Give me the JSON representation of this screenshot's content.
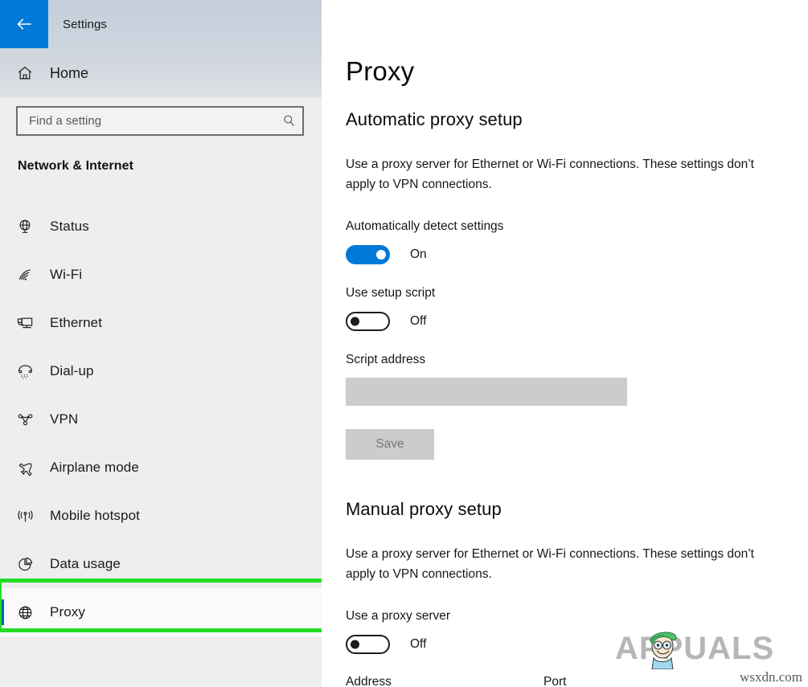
{
  "window": {
    "title": "Settings",
    "back_icon": "back-arrow-icon"
  },
  "sidebar": {
    "home": {
      "label": "Home",
      "icon": "home-icon"
    },
    "search": {
      "value": "",
      "placeholder": "Find a setting",
      "icon": "search-icon"
    },
    "category": "Network & Internet",
    "items": [
      {
        "label": "Status",
        "icon": "globe-icon",
        "selected": false
      },
      {
        "label": "Wi-Fi",
        "icon": "wifi-icon",
        "selected": false
      },
      {
        "label": "Ethernet",
        "icon": "ethernet-icon",
        "selected": false
      },
      {
        "label": "Dial-up",
        "icon": "dialup-phone-icon",
        "selected": false
      },
      {
        "label": "VPN",
        "icon": "vpn-icon",
        "selected": false
      },
      {
        "label": "Airplane mode",
        "icon": "airplane-icon",
        "selected": false
      },
      {
        "label": "Mobile hotspot",
        "icon": "hotspot-icon",
        "selected": false
      },
      {
        "label": "Data usage",
        "icon": "pie-chart-icon",
        "selected": false
      },
      {
        "label": "Proxy",
        "icon": "globe-grid-icon",
        "selected": true
      }
    ]
  },
  "main": {
    "page_title": "Proxy",
    "automatic_section": {
      "heading": "Automatic proxy setup",
      "description": "Use a proxy server for Ethernet or Wi-Fi connections. These settings don’t apply to VPN connections.",
      "auto_detect": {
        "label": "Automatically detect settings",
        "state": "On",
        "on": true
      },
      "setup_script": {
        "label": "Use setup script",
        "state": "Off",
        "on": false
      },
      "script_address": {
        "label": "Script address",
        "value": "",
        "disabled": true
      },
      "save_button": {
        "label": "Save",
        "disabled": true
      }
    },
    "manual_section": {
      "heading": "Manual proxy setup",
      "description": "Use a proxy server for Ethernet or Wi-Fi connections. These settings don’t apply to VPN connections.",
      "use_proxy": {
        "label": "Use a proxy server",
        "state": "Off",
        "on": false
      },
      "address_label": "Address",
      "port_label": "Port"
    }
  },
  "watermark": {
    "brand": "APPUALS",
    "site": "wsxdn.com"
  },
  "colors": {
    "accent_blue": "#0078d7",
    "selection_bar": "#0065b3",
    "callout_green": "#22dd22",
    "sidebar_bg": "#eeeeee",
    "disabled_gray": "#cccccc"
  }
}
